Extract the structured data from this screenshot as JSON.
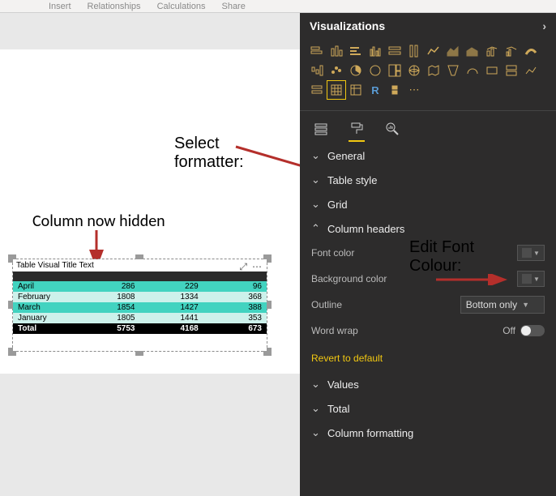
{
  "ribbon": {
    "tab1": "Insert",
    "tab2": "Relationships",
    "tab3": "Calculations",
    "tab4": "Share"
  },
  "annotations": {
    "select_formatter_line1": "Select",
    "select_formatter_line2": "formatter:",
    "column_hidden": "Column now hidden",
    "edit_font_line1": "Edit Font",
    "edit_font_line2": "Colour:"
  },
  "table_visual": {
    "title_text": "Table Visual Title Text",
    "rows": [
      {
        "c1": "April",
        "c2": "286",
        "c3": "229",
        "c4": "96"
      },
      {
        "c1": "February",
        "c2": "1808",
        "c3": "1334",
        "c4": "368"
      },
      {
        "c1": "March",
        "c2": "1854",
        "c3": "1427",
        "c4": "388"
      },
      {
        "c1": "January",
        "c2": "1805",
        "c3": "1441",
        "c4": "353"
      }
    ],
    "total_label": "Total",
    "total": {
      "c2": "5753",
      "c3": "4168",
      "c4": "673"
    }
  },
  "viz_pane": {
    "title": "Visualizations",
    "sections": {
      "general": "General",
      "table_style": "Table style",
      "grid": "Grid",
      "column_headers": "Column headers",
      "values": "Values",
      "total": "Total",
      "column_formatting": "Column formatting"
    },
    "column_headers": {
      "font_color_label": "Font color",
      "bg_color_label": "Background color",
      "outline_label": "Outline",
      "outline_value": "Bottom only",
      "word_wrap_label": "Word wrap",
      "word_wrap_value": "Off"
    },
    "revert_label": "Revert to default"
  }
}
